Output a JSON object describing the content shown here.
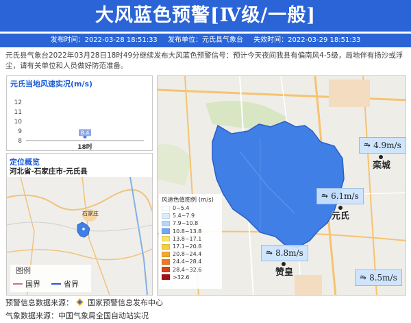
{
  "header": {
    "title": "大风蓝色预警[Ⅳ级/一般]",
    "publish_time": "发布时间：2022-03-28 18:51:33",
    "publisher": "发布单位：元氏县气象台",
    "expire_time": "失效时间：2022-03-29 18:51:33"
  },
  "description": "元氏县气象台2022年03月28日18时49分继续发布大风蓝色预警信号：预计今天夜间我县有偏南风4-5级，局地伴有扬沙或浮尘，请有关单位和人员做好防范准备。",
  "wind_chart": {
    "title": "元氏当地风速实况(m/s)",
    "chart_data": {
      "type": "scatter",
      "title": "元氏当地风速实况(m/s)",
      "categories": [
        "18时"
      ],
      "values": [
        8.4
      ],
      "data_labels": [
        "8.4"
      ],
      "yticks": [
        "12",
        "11",
        "10",
        "9",
        "8"
      ],
      "ylim": [
        8,
        12
      ],
      "grid": false
    }
  },
  "locate": {
    "title": "定位概览",
    "path": "河北省-石家庄市-元氏县",
    "map_label": "石家庄",
    "legend_title": "图例",
    "legend_items": [
      {
        "label": "国界",
        "color": "#d46a8a"
      },
      {
        "label": "省界",
        "color": "#2255d6"
      }
    ]
  },
  "scale_legend": {
    "title": "风速色值图例 (m/s)",
    "items": [
      {
        "label": "0~5.4",
        "color": "#ffffff"
      },
      {
        "label": "5.4~7.9",
        "color": "#d9ecff"
      },
      {
        "label": "7.9~10.8",
        "color": "#b5d7fa"
      },
      {
        "label": "10.8~13.8",
        "color": "#6fa9ef"
      },
      {
        "label": "13.8~17.1",
        "color": "#f7e36a"
      },
      {
        "label": "17.1~20.8",
        "color": "#f6cd3e"
      },
      {
        "label": "20.8~24.4",
        "color": "#f4a72c"
      },
      {
        "label": "24.4~28.4",
        "color": "#ec7a22"
      },
      {
        "label": "28.4~32.6",
        "color": "#d7421c"
      },
      {
        "label": ">32.6",
        "color": "#a51010"
      }
    ]
  },
  "stations": [
    {
      "name": "栾城",
      "speed": "4.9m/s"
    },
    {
      "name": "元氏",
      "speed": "6.1m/s"
    },
    {
      "name": "赞皇",
      "speed": "8.8m/s"
    },
    {
      "name": "",
      "speed": "8.5m/s"
    }
  ],
  "footer": {
    "warning_source": "预警信息数据来源：",
    "warning_source_name": "国家预警信息发布中心",
    "weather_source": "气象数据来源：中国气象局全国自动站实况"
  },
  "colors": {
    "header_bg": "#2a64d6",
    "warning_area": "#3f7fe6",
    "accent_title": "#1d5ed6"
  }
}
